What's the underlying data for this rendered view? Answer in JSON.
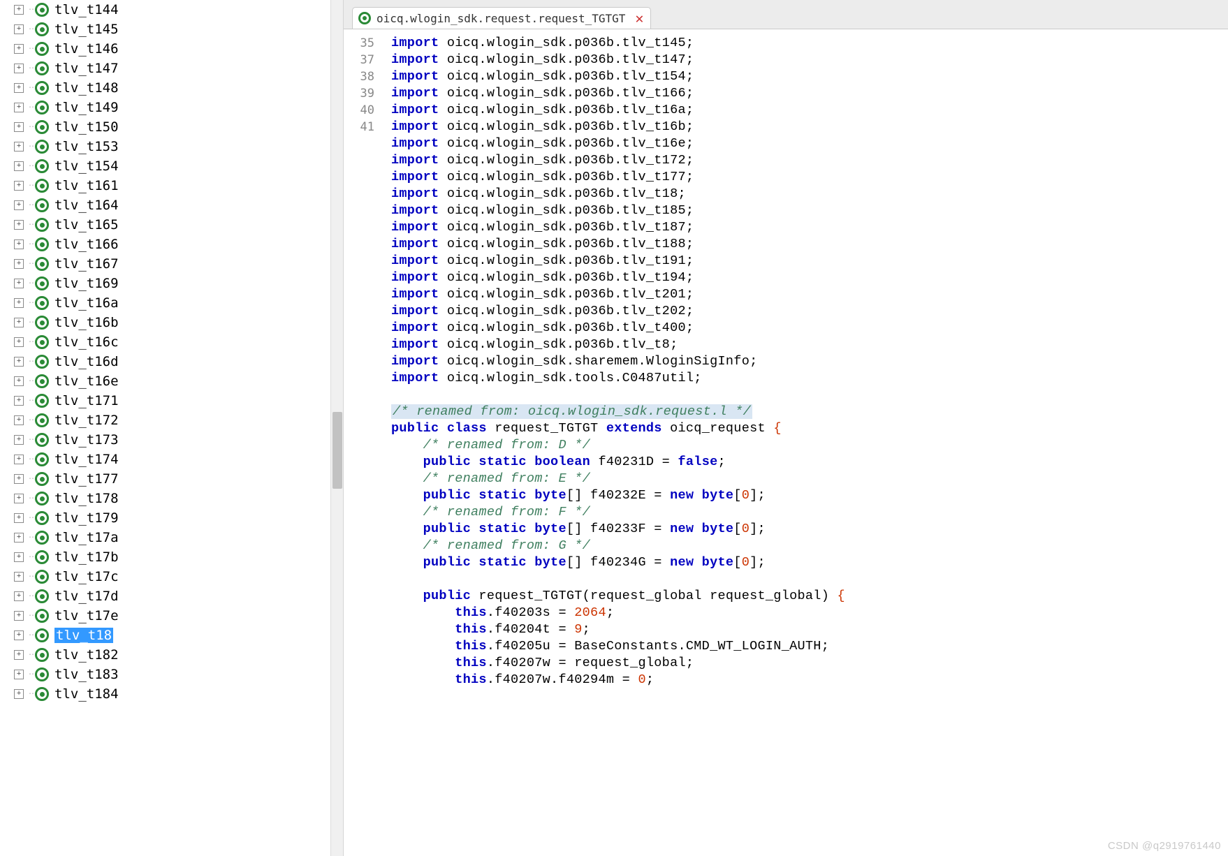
{
  "tree": {
    "items": [
      {
        "label": "tlv_t144"
      },
      {
        "label": "tlv_t145"
      },
      {
        "label": "tlv_t146"
      },
      {
        "label": "tlv_t147"
      },
      {
        "label": "tlv_t148"
      },
      {
        "label": "tlv_t149"
      },
      {
        "label": "tlv_t150"
      },
      {
        "label": "tlv_t153"
      },
      {
        "label": "tlv_t154"
      },
      {
        "label": "tlv_t161"
      },
      {
        "label": "tlv_t164"
      },
      {
        "label": "tlv_t165"
      },
      {
        "label": "tlv_t166"
      },
      {
        "label": "tlv_t167"
      },
      {
        "label": "tlv_t169"
      },
      {
        "label": "tlv_t16a"
      },
      {
        "label": "tlv_t16b"
      },
      {
        "label": "tlv_t16c"
      },
      {
        "label": "tlv_t16d"
      },
      {
        "label": "tlv_t16e"
      },
      {
        "label": "tlv_t171"
      },
      {
        "label": "tlv_t172"
      },
      {
        "label": "tlv_t173"
      },
      {
        "label": "tlv_t174"
      },
      {
        "label": "tlv_t177"
      },
      {
        "label": "tlv_t178"
      },
      {
        "label": "tlv_t179"
      },
      {
        "label": "tlv_t17a"
      },
      {
        "label": "tlv_t17b"
      },
      {
        "label": "tlv_t17c"
      },
      {
        "label": "tlv_t17d"
      },
      {
        "label": "tlv_t17e"
      },
      {
        "label": "tlv_t18",
        "selected": true
      },
      {
        "label": "tlv_t182"
      },
      {
        "label": "tlv_t183"
      },
      {
        "label": "tlv_t184"
      }
    ]
  },
  "tab": {
    "title": "oicq.wlogin_sdk.request.request_TGTGT"
  },
  "code": {
    "import_prefix": "oicq.wlogin_sdk.p036b.",
    "imports_p036b": [
      "tlv_t145",
      "tlv_t147",
      "tlv_t154",
      "tlv_t166",
      "tlv_t16a",
      "tlv_t16b",
      "tlv_t16e",
      "tlv_t172",
      "tlv_t177",
      "tlv_t18",
      "tlv_t185",
      "tlv_t187",
      "tlv_t188",
      "tlv_t191",
      "tlv_t194",
      "tlv_t201",
      "tlv_t202",
      "tlv_t400",
      "tlv_t8"
    ],
    "import_extra1": "oicq.wlogin_sdk.sharemem.WloginSigInfo",
    "import_extra2": "oicq.wlogin_sdk.tools.C0487util",
    "renamed_class": "/* renamed from: oicq.wlogin_sdk.request.l */",
    "class_decl_pre": "public class ",
    "class_name": "request_TGTGT",
    "class_extends": " extends ",
    "super_name": "oicq_request",
    "cmt_D": "/* renamed from: D */",
    "field_D": "f40231D",
    "cmt_E": "/* renamed from: E */",
    "field_E": "f40232E",
    "cmt_F": "/* renamed from: F */",
    "field_F": "f40233F",
    "cmt_G": "/* renamed from: G */",
    "field_G": "f40234G",
    "ctor_name": "request_TGTGT",
    "ctor_param": "request_global request_global",
    "a1_field": "f40203s",
    "a1_val": "2064",
    "a2_field": "f40204t",
    "a2_val": "9",
    "a3_field": "f40205u",
    "a3_rhs": "BaseConstants.CMD_WT_LOGIN_AUTH",
    "a4_field": "f40207w",
    "a4_rhs": "request_global",
    "a5_lhs": "f40207w.f40294m",
    "a5_val": "0",
    "line_nums": {
      "n1": "35",
      "n2": "37",
      "n3": "38",
      "n4": "39",
      "n5": "40",
      "n6": "41"
    },
    "kw": {
      "import": "import",
      "public": "public",
      "class": "class",
      "extends": "extends",
      "static": "static",
      "boolean": "boolean",
      "byte": "byte",
      "new": "new",
      "false": "false",
      "this": "this"
    }
  },
  "watermark": "CSDN @q2919761440"
}
